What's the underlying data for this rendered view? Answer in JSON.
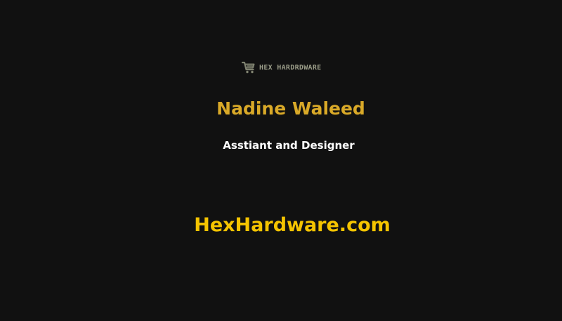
{
  "logo": {
    "text": "HEX HARDRDWARE",
    "icon": "shopping-cart-icon",
    "color": "#9a9c88"
  },
  "person": {
    "name": "Nadine Waleed",
    "role": "Asstiant and Designer"
  },
  "website": "HexHardware.com",
  "colors": {
    "background": "#111111",
    "name": "#d9a928",
    "role": "#ffffff",
    "website": "#f5c400"
  }
}
